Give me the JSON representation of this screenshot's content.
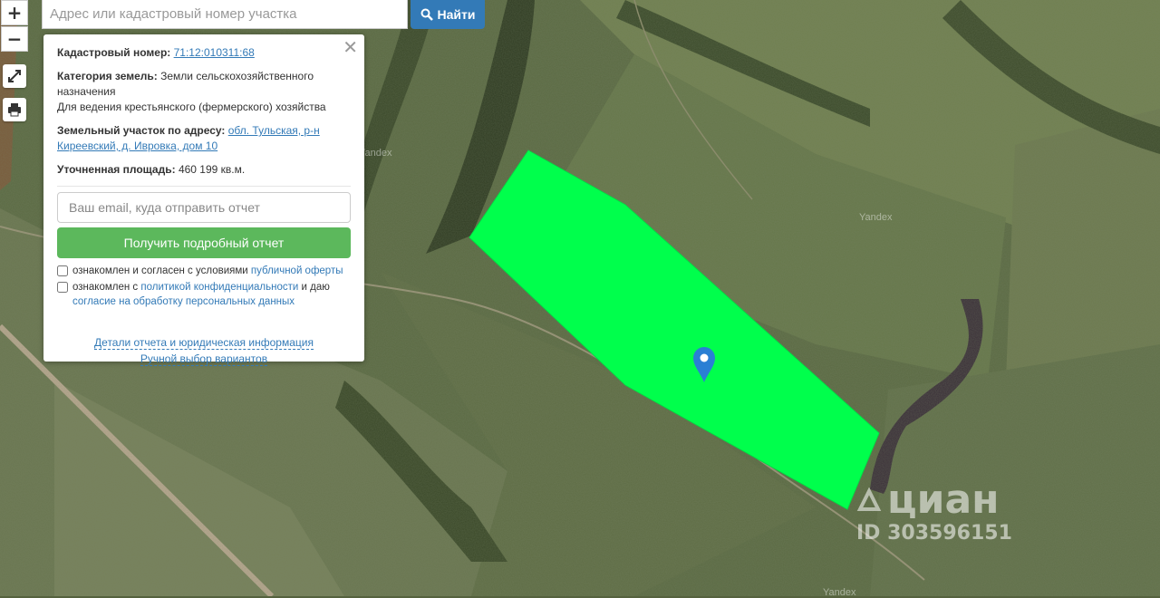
{
  "map_controls": {
    "zoom_in": "+",
    "zoom_out": "−"
  },
  "search": {
    "placeholder": "Адрес или кадастровый номер участка",
    "button_label": "Найти"
  },
  "panel": {
    "close": "✕",
    "cadastral_label": "Кадастровый номер:",
    "cadastral_value": "71:12:010311:68",
    "category_label": "Категория земель:",
    "category_value": "Земли сельскохозяйственного назначения",
    "usage": "Для ведения крестьянского (фермерского) хозяйства",
    "address_label": "Земельный участок по адресу:",
    "address_value": "обл. Тульская, р-н Киреевский, д. Ивровка, дом 10",
    "area_label": "Уточненная площадь:",
    "area_value": "460 199 кв.м.",
    "email_placeholder": "Ваш email, куда отправить отчет",
    "report_button": "Получить подробный отчет",
    "consent1_text": "ознакомлен и согласен с условиями",
    "consent1_link": "публичной оферты",
    "consent2_text_a": "ознакомлен с",
    "consent2_link_a": "политикой конфиденциальности",
    "consent2_text_b": "и даю",
    "consent2_link_b": "согласие на обработку персональных данных",
    "footer_link1": "Детали отчета и юридическая информация",
    "footer_link2": "Ручной выбор вариантов"
  },
  "map_labels": {
    "yandex1": "Yandex",
    "yandex2": "Yandex",
    "yandex3": "Yandex"
  },
  "watermark": {
    "brand": "циан",
    "id": "ID 303596151"
  },
  "colors": {
    "parcel": "#00ff4c",
    "accent": "#337ab7",
    "report_button": "#5cb85c"
  }
}
